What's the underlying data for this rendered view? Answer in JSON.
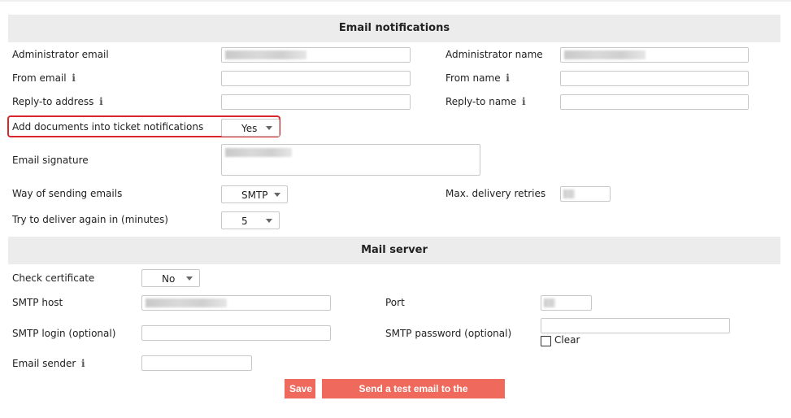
{
  "email_notifications": {
    "title": "Email notifications",
    "administrator_email_label": "Administrator email",
    "administrator_email_value": "",
    "administrator_name_label": "Administrator name",
    "administrator_name_value": "",
    "from_email_label": "From email",
    "from_email_value": "",
    "from_name_label": "From name",
    "from_name_value": "",
    "reply_to_address_label": "Reply-to address",
    "reply_to_address_value": "",
    "reply_to_name_label": "Reply-to name",
    "reply_to_name_value": "",
    "add_documents_label": "Add documents into ticket notifications",
    "add_documents_value": "Yes",
    "email_signature_label": "Email signature",
    "way_of_sending_label": "Way of sending emails",
    "way_of_sending_value": "SMTP",
    "max_delivery_retries_label": "Max. delivery retries",
    "retry_interval_label": "Try to deliver again in (minutes)",
    "retry_interval_value": "5"
  },
  "mail_server": {
    "title": "Mail server",
    "check_certificate_label": "Check certificate",
    "check_certificate_value": "No",
    "smtp_host_label": "SMTP host",
    "port_label": "Port",
    "smtp_login_label": "SMTP login (optional)",
    "smtp_password_label": "SMTP password (optional)",
    "clear_label": "Clear",
    "email_sender_label": "Email sender"
  },
  "actions": {
    "save_label": "Save",
    "test_email_label": "Send a test email to the administrator"
  },
  "icons": {
    "info": "info-icon",
    "dropdown": "chevron-down-icon"
  },
  "colors": {
    "button_bg": "#ef6a5d",
    "highlight_border": "#d9262c",
    "section_header_bg": "#ececec"
  }
}
